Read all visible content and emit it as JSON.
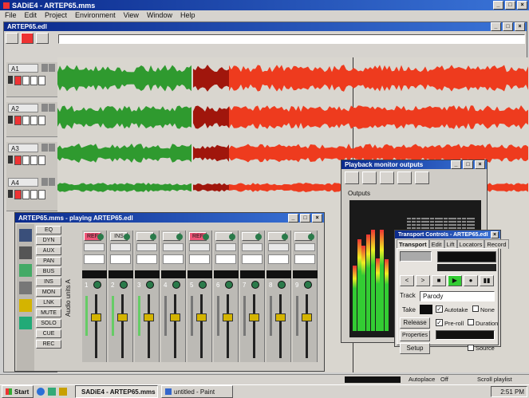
{
  "app": {
    "title": "SADiE4 - ARTEP65.mms",
    "accent": "#0b2a8c",
    "waveform_colors": {
      "green": "#2f9a2f",
      "red": "#ee3b1e",
      "dark_red": "#a0160c"
    }
  },
  "menu": [
    "File",
    "Edit",
    "Project",
    "Environment",
    "View",
    "Window",
    "Help"
  ],
  "edl_window": {
    "title": "ARTEP65.edl"
  },
  "tracks": [
    {
      "name": "A1",
      "icon": "speaker-icon"
    },
    {
      "name": "A2",
      "icon": "speaker-icon"
    },
    {
      "name": "A3",
      "icon": "speaker-icon"
    },
    {
      "name": "A4",
      "icon": "speaker-icon"
    }
  ],
  "mixer": {
    "title": "ARTEP65.mms - playing ARTEP65.edl",
    "side_buttons": [
      "EQ",
      "DYN",
      "AUX",
      "PAN",
      "BUS",
      "INS",
      "MON",
      "LNK",
      "MUTE",
      "SOLO",
      "CUE",
      "REC"
    ],
    "strip_top_labels": [
      "REF",
      "INS",
      "",
      "",
      "REF",
      "",
      "",
      "",
      ""
    ],
    "channel_numbers": [
      "1",
      "2",
      "3",
      "4",
      "5",
      "6",
      "7",
      "8",
      "9"
    ],
    "vertical_label": "Audio units A"
  },
  "meters_window": {
    "title": "Playback monitor outputs",
    "outputs_label": "Outputs"
  },
  "transport": {
    "title": "Transport Controls - ARTEP65.edl",
    "tabs": [
      "Transport",
      "Edit",
      "Lift",
      "Locators",
      "Record"
    ],
    "active_tab": "Transport",
    "transport_buttons": [
      "<",
      ">",
      "■",
      "▶",
      "●",
      "▮▮"
    ],
    "track_label": "Track",
    "track_value": "Parody",
    "take_label": "Take",
    "autotake_label": "Autotake",
    "autotake_checked": true,
    "none_label": "None",
    "release_label": "Release",
    "pre_roll_label": "Pre-roll",
    "pre_roll_checked": true,
    "duration_label": "Duration",
    "properties_label": "Properties",
    "setup_label": "Setup",
    "source_label": "Source"
  },
  "statusbar": {
    "autoplace_label": "Autoplace",
    "autoplace_value": "Off",
    "scroll_label": "Scroll playlist"
  },
  "taskbar": {
    "start_label": "Start",
    "tasks": [
      "SADiE4 - ARTEP65.mms",
      "untitled - Paint"
    ],
    "clock": "2:51 PM"
  }
}
